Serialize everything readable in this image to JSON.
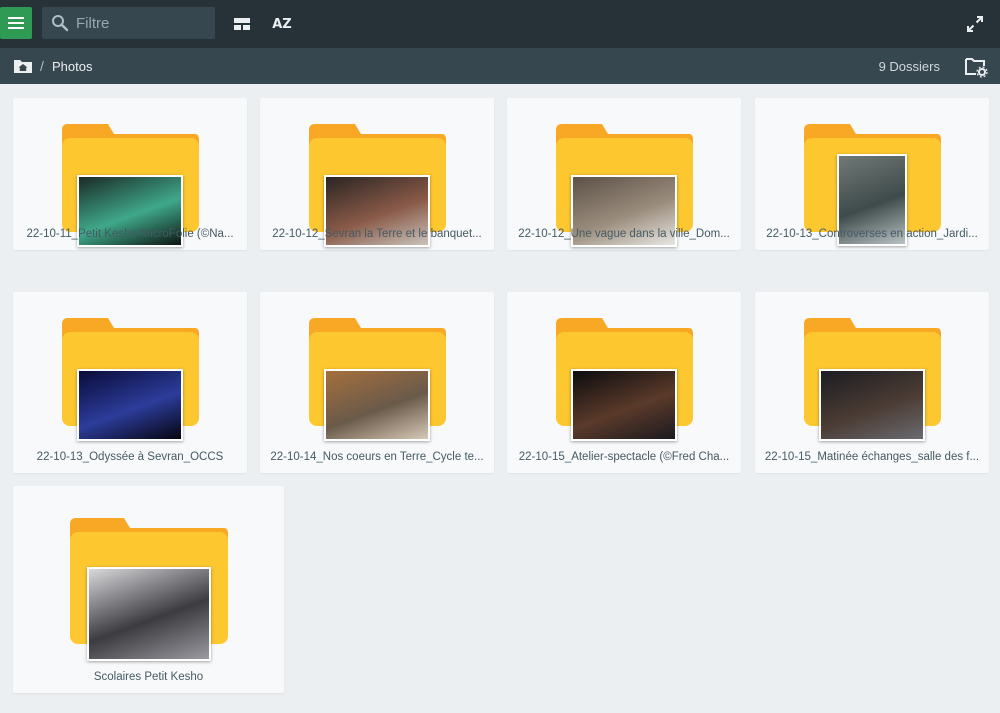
{
  "toolbar": {
    "menu_icon": "hamburger-icon",
    "search_placeholder": "Filtre",
    "search_icon": "search-icon",
    "view_icon": "view-layout-icon",
    "sort_label": "AZ",
    "sort_icon": "sort-alpha-icon",
    "fullscreen_icon": "fullscreen-icon"
  },
  "breadcrumb": {
    "home_icon": "home-folder-icon",
    "separator": "/",
    "current": "Photos",
    "count_label": "9 Dossiers",
    "settings_icon": "folder-settings-icon"
  },
  "folders": [
    {
      "name": "22-10-11_Petit Kesho-MicroFolie (©Na...",
      "photo_colors": [
        "#1b2a26",
        "#3fa88a",
        "#0e1512"
      ]
    },
    {
      "name": "22-10-12_Sevran la Terre et le banquet...",
      "photo_colors": [
        "#2a2523",
        "#8a5a48",
        "#c9c3bb"
      ]
    },
    {
      "name": "22-10-12_Une vague dans la ville_Dom...",
      "photo_colors": [
        "#5c5148",
        "#9a8c7c",
        "#e8e6e2"
      ]
    },
    {
      "name": "22-10-13_Controverses en action_Jardi...",
      "photo_colors": [
        "#6f7a78",
        "#3f4a4a",
        "#b9c3c6"
      ]
    },
    {
      "name": "22-10-13_Odyssée à Sevran_OCCS",
      "photo_colors": [
        "#0a0c3a",
        "#2c3c9a",
        "#050510"
      ]
    },
    {
      "name": "22-10-14_Nos coeurs en Terre_Cycle te...",
      "photo_colors": [
        "#a56f3d",
        "#6a5a4a",
        "#d7c9b8"
      ]
    },
    {
      "name": "22-10-15_Atelier-spectacle (©Fred Cha...",
      "photo_colors": [
        "#0d0c0f",
        "#5a3a2a",
        "#1c1a1f"
      ]
    },
    {
      "name": "22-10-15_Matinée échanges_salle des f...",
      "photo_colors": [
        "#1c1c22",
        "#4b3c34",
        "#6a6a70"
      ]
    },
    {
      "name": "Scolaires Petit Kesho",
      "photo_colors": [
        "#d9d9dc",
        "#3b3b40",
        "#9a9aa0"
      ]
    }
  ],
  "folder_colors": {
    "back": "#f9a825",
    "front": "#fdc72f"
  }
}
